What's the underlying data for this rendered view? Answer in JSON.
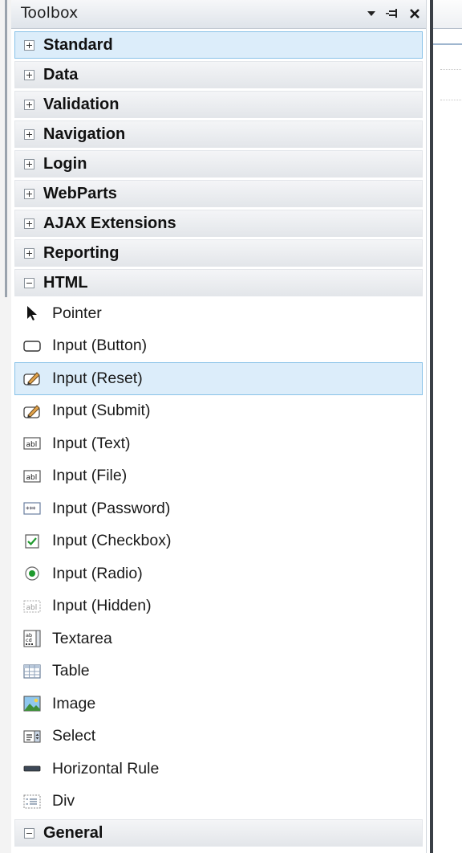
{
  "toolbox": {
    "title": "Toolbox",
    "controls": {
      "dropdown_icon": "triangle-down-icon",
      "pin_icon": "pin-icon",
      "close_icon": "close-icon"
    }
  },
  "categories_top": [
    {
      "label": "Standard",
      "state": "collapsed",
      "selected": true
    },
    {
      "label": "Data",
      "state": "collapsed"
    },
    {
      "label": "Validation",
      "state": "collapsed"
    },
    {
      "label": "Navigation",
      "state": "collapsed"
    },
    {
      "label": "Login",
      "state": "collapsed"
    },
    {
      "label": "WebParts",
      "state": "collapsed"
    },
    {
      "label": "AJAX Extensions",
      "state": "collapsed"
    },
    {
      "label": "Reporting",
      "state": "collapsed"
    }
  ],
  "html_category": {
    "label": "HTML",
    "state": "expanded"
  },
  "html_items": [
    {
      "label": "Pointer",
      "icon": "pointer-arrow-icon"
    },
    {
      "label": "Input (Button)",
      "icon": "button-icon"
    },
    {
      "label": "Input (Reset)",
      "icon": "reset-pencil-icon",
      "selected": true
    },
    {
      "label": "Input (Submit)",
      "icon": "submit-pencil-icon"
    },
    {
      "label": "Input (Text)",
      "icon": "textbox-abl-icon"
    },
    {
      "label": "Input (File)",
      "icon": "file-abl-icon"
    },
    {
      "label": "Input (Password)",
      "icon": "password-icon"
    },
    {
      "label": "Input (Checkbox)",
      "icon": "checkbox-icon"
    },
    {
      "label": "Input (Radio)",
      "icon": "radio-icon"
    },
    {
      "label": "Input (Hidden)",
      "icon": "hidden-abl-icon"
    },
    {
      "label": "Textarea",
      "icon": "textarea-icon"
    },
    {
      "label": "Table",
      "icon": "table-icon"
    },
    {
      "label": "Image",
      "icon": "image-icon"
    },
    {
      "label": "Select",
      "icon": "select-icon"
    },
    {
      "label": "Horizontal Rule",
      "icon": "horizontal-rule-icon"
    },
    {
      "label": "Div",
      "icon": "div-icon"
    }
  ],
  "general_category": {
    "label": "General",
    "state": "expanded"
  },
  "colors": {
    "selection_fill": "#dcedfa",
    "selection_border": "#88c2e8",
    "category_fill": "#e3e6ea"
  }
}
